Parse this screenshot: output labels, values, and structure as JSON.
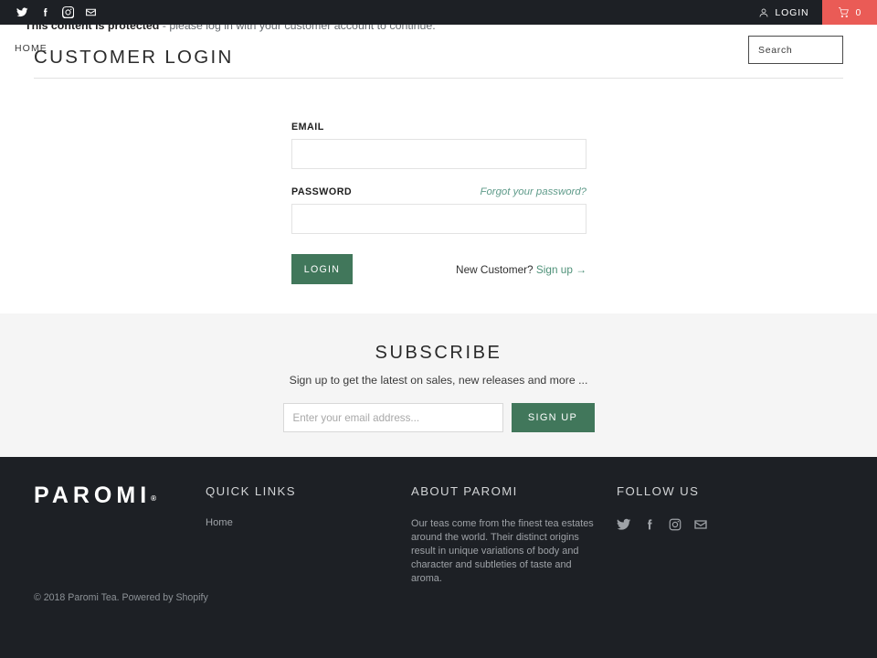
{
  "topbar": {
    "social": [
      {
        "name": "twitter-icon",
        "label": "Twitter"
      },
      {
        "name": "facebook-icon",
        "label": "Facebook"
      },
      {
        "name": "instagram-icon",
        "label": "Instagram"
      },
      {
        "name": "email-icon",
        "label": "Email"
      }
    ],
    "login_label": "LOGIN",
    "cart_count": "0",
    "cart_bg": "#ea5b56"
  },
  "banner": {
    "bold_text": "This content is protected",
    "rest_text": " - please log in with your customer account to continue."
  },
  "header": {
    "breadcrumb": "HOME",
    "title": "CUSTOMER LOGIN",
    "search_placeholder": "Search",
    "search_value": ""
  },
  "login_form": {
    "email_label": "EMAIL",
    "email_value": "",
    "password_label": "PASSWORD",
    "password_value": "",
    "forgot_label": "Forgot your password?",
    "submit_label": "LOGIN",
    "new_customer_text": "New Customer?",
    "signup_label": "Sign up →",
    "button_color": "#41775b"
  },
  "subscribe": {
    "title": "SUBSCRIBE",
    "subtitle": "Sign up to get the latest on sales, new releases and more ...",
    "input_placeholder": "Enter your email address...",
    "input_value": "",
    "button_label": "SIGN UP",
    "section_bg": "#f5f5f5"
  },
  "footer": {
    "logo": "PAROMI",
    "logo_mark": "®",
    "quick_links": {
      "title": "QUICK LINKS",
      "items": [
        {
          "label": "Home"
        }
      ]
    },
    "about": {
      "title": "ABOUT PAROMI",
      "text": "Our teas come from the finest tea estates around the world. Their distinct origins result in unique variations of body and character and subtleties of taste and aroma."
    },
    "follow": {
      "title": "FOLLOW US",
      "social": [
        {
          "name": "twitter-icon",
          "label": "Twitter"
        },
        {
          "name": "facebook-icon",
          "label": "Facebook"
        },
        {
          "name": "instagram-icon",
          "label": "Instagram"
        },
        {
          "name": "email-icon",
          "label": "Email"
        }
      ]
    },
    "copyright_prefix": "© 2018 ",
    "copyright_brand": "Paromi Tea",
    "copyright_mid": ". Powered by ",
    "copyright_platform": "Shopify",
    "bg": "#1d2025"
  }
}
